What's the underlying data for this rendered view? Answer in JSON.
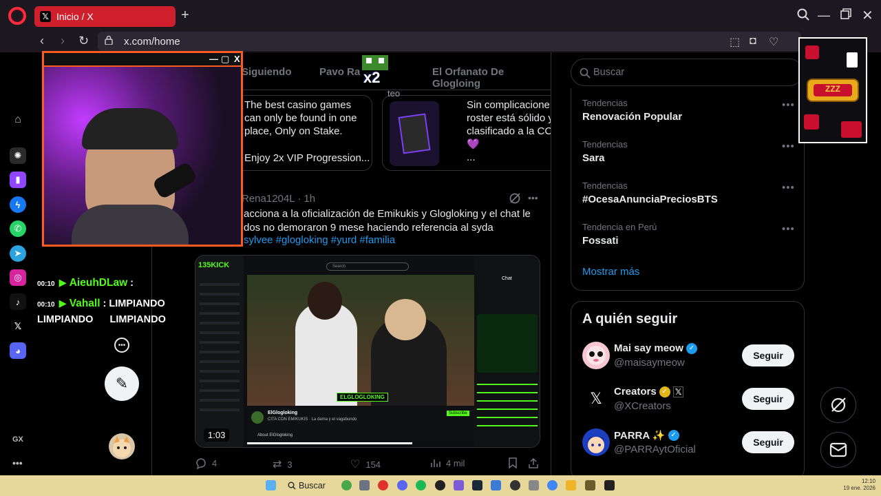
{
  "browser": {
    "tab_title": "Inicio / X",
    "new_tab": "+",
    "url": "x.com/home"
  },
  "sidebar": {
    "gx_label": "GX",
    "more": "•••"
  },
  "feed": {
    "tabs": [
      "Siguiendo",
      "Pavo Ra",
      "El Orfanato De Glogloing"
    ],
    "promo1": {
      "line1": "The best casino games",
      "line2": "can only be found in one",
      "line3": "place, Only on Stake.",
      "line4": "Enjoy 2x VIP Progression..."
    },
    "promo2": {
      "line1": "Sin complicacione",
      "line2": "roster está sólido y",
      "line3": "clasificado a la CC",
      "line4": "..."
    },
    "tweet": {
      "author": "Rena1204L",
      "time": "· 1h",
      "line1": "acciona a la oficialización de Emikukis y Glogloking  y el chat le",
      "line2": "dos no demoraron 9 mese haciendo referencia al syda",
      "hashtags": "sylvee #glogloking #yurd #familia",
      "duration": "1:03",
      "replies": "4",
      "reposts": "3",
      "likes": "154",
      "views": "4 mil"
    },
    "video": {
      "logo": "135KICK",
      "search": "Search",
      "streamer": "ElGlogloking",
      "stream_title": "CITA CON EMIKUKIS · La dama y el vagabundo",
      "banner": "ELGLOGLOKING",
      "subscribe": "Subscribe",
      "about": "About ElGlogloking",
      "chat": "Chat"
    }
  },
  "right": {
    "search_placeholder": "Buscar",
    "trends": [
      {
        "category": "Tendencias",
        "name": "Renovación Popular"
      },
      {
        "category": "Tendencias",
        "name": "Sara"
      },
      {
        "category": "Tendencias",
        "name": "#OcesaAnunciaPreciosBTS"
      },
      {
        "category": "Tendencia en Perú",
        "name": "Fossati"
      }
    ],
    "trend_more": "•••",
    "show_more": "Mostrar más",
    "follow_title": "A quién seguir",
    "follow_button": "Seguir",
    "suggestions": [
      {
        "name": "Mai say meow",
        "handle": "@maisaymeow"
      },
      {
        "name": "Creators",
        "handle": "@XCreators"
      },
      {
        "name": "PARRA ✨",
        "handle": "@PARRAytOficial"
      }
    ]
  },
  "stream": {
    "chat": [
      {
        "time": "00:10",
        "user": "AieuhDLaw",
        "message": ":"
      },
      {
        "time": "00:10",
        "user": "Vahall",
        "message": ": LIMPIANDO"
      }
    ],
    "chat_cont": "LIMPIANDO      LIMPIANDO",
    "x2": "x2",
    "overlay_text": "teo"
  },
  "taskbar": {
    "search": "Buscar",
    "time": "12:10",
    "date": "19 ene. 2026"
  },
  "colors": {
    "accent": "#1d9bf0",
    "tab": "#cf1e2c",
    "kick": "#53fc18",
    "cam_border": "#ff5a1f",
    "taskbar": "#e7d79a"
  }
}
